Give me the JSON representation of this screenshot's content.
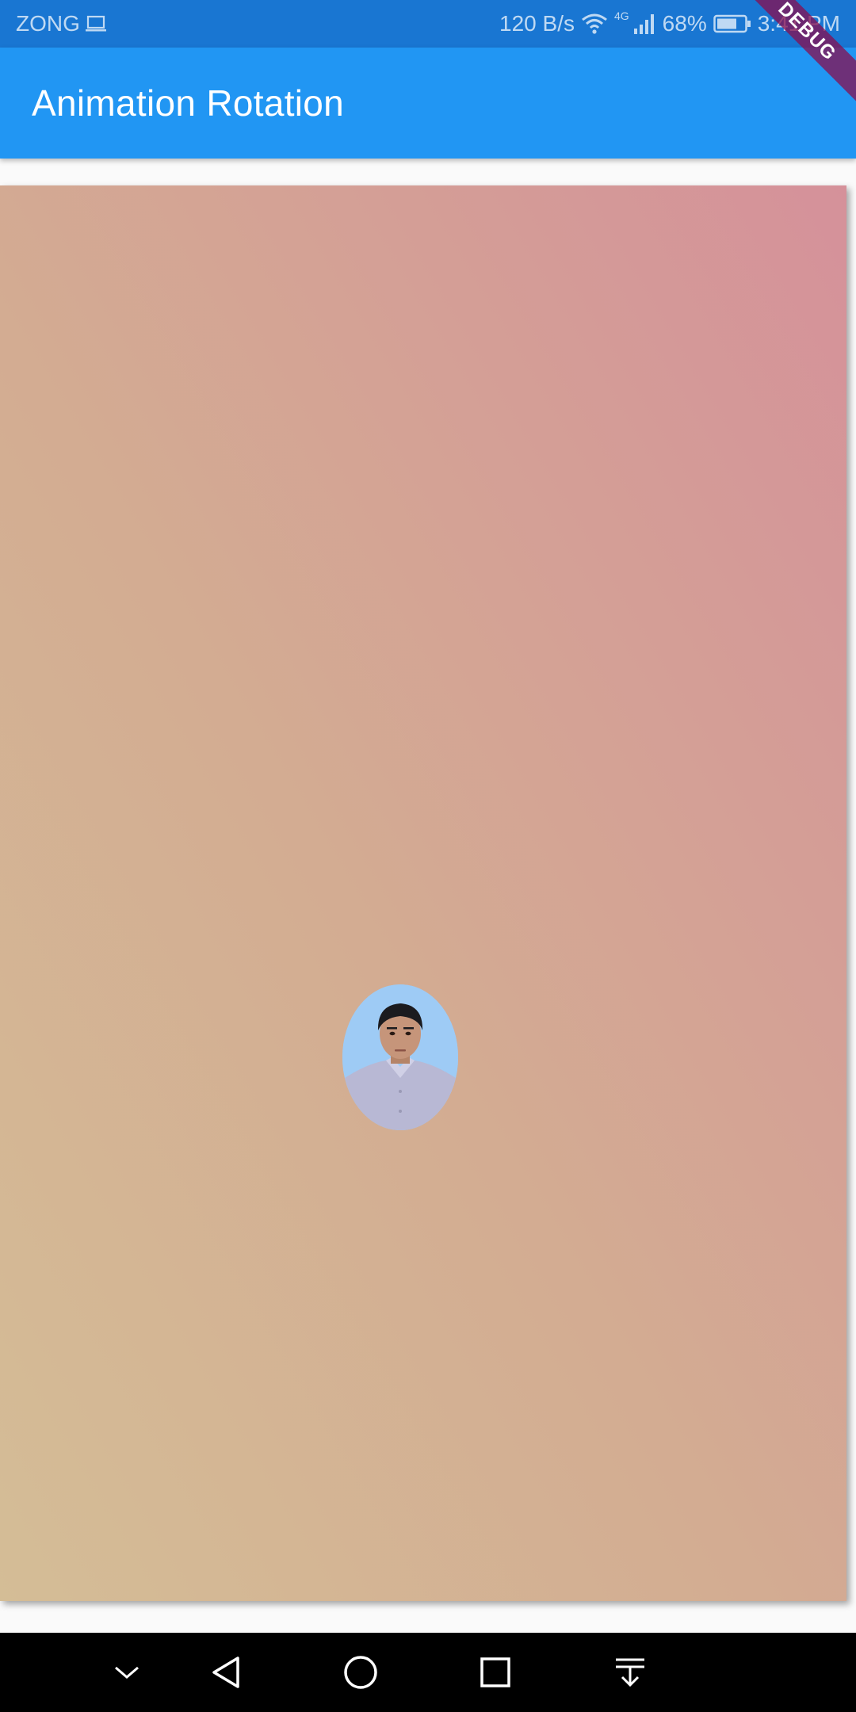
{
  "status_bar": {
    "carrier": "ZONG",
    "net_speed": "120 B/s",
    "network_type": "4G",
    "battery": "68%",
    "time": "3:41 PM"
  },
  "app_bar": {
    "title": "Animation Rotation"
  },
  "debug_banner": {
    "label": "DEBUG"
  },
  "gradient": {
    "colors": [
      "#d4bd96",
      "#d3ac92",
      "#d5919a"
    ]
  },
  "avatar": {
    "background": "#9ecbf5"
  },
  "nav_bar": {
    "icons": [
      "chevron-down-icon",
      "back-icon",
      "home-icon",
      "recents-icon",
      "notification-pull-icon"
    ]
  }
}
